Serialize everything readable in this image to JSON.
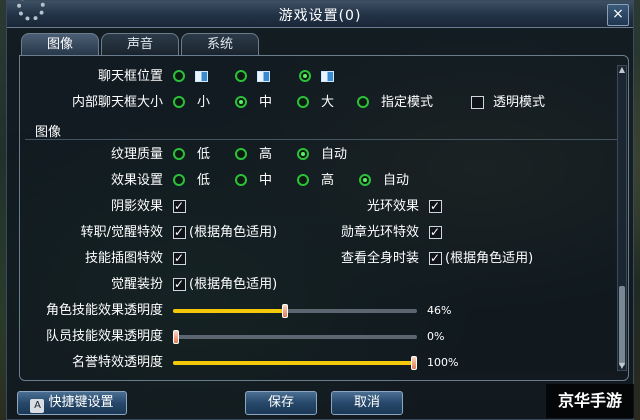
{
  "window": {
    "title": "游戏设置(0)",
    "close_label": "×"
  },
  "tabs": [
    {
      "label": "图像"
    },
    {
      "label": "声音"
    },
    {
      "label": "系统"
    }
  ],
  "chat_position": {
    "label": "聊天框位置",
    "selected": 2
  },
  "chat_size": {
    "label": "内部聊天框大小",
    "options": [
      "小",
      "中",
      "大",
      "指定模式"
    ],
    "selected": 1,
    "transparent_label": "透明模式",
    "transparent_checked": false
  },
  "section_image": "图像",
  "texture": {
    "label": "纹理质量",
    "options": [
      "低",
      "高",
      "自动"
    ],
    "selected": 2
  },
  "effect": {
    "label": "效果设置",
    "options": [
      "低",
      "中",
      "高",
      "自动"
    ],
    "selected": 3
  },
  "shadow": {
    "label": "阴影效果",
    "checked": true
  },
  "halo": {
    "label": "光环效果",
    "checked": true
  },
  "transfer": {
    "label": "转职/觉醒特效",
    "value": "(根据角色适用)",
    "checked": true
  },
  "medal": {
    "label": "勋章光环特效",
    "checked": true
  },
  "skill_illustration": {
    "label": "技能插图特效",
    "checked": true
  },
  "full_outfit": {
    "label": "查看全身时装",
    "value": "(根据角色适用)",
    "checked": true
  },
  "awaken_outfit": {
    "label": "觉醒装扮",
    "value": "(根据角色适用)",
    "checked": true
  },
  "sliders": [
    {
      "label": "角色技能效果透明度",
      "value": 46,
      "text": "46%"
    },
    {
      "label": "队员技能效果透明度",
      "value": 0,
      "text": "0%"
    },
    {
      "label": "名誉特效透明度",
      "value": 100,
      "text": "100%"
    }
  ],
  "buttons": {
    "shortcut": "快捷键设置",
    "save": "保存",
    "cancel": "取消"
  },
  "watermark": "京华手游",
  "colors": {
    "radio": "#2bc23a",
    "slider_fill": "#f5c90b"
  }
}
